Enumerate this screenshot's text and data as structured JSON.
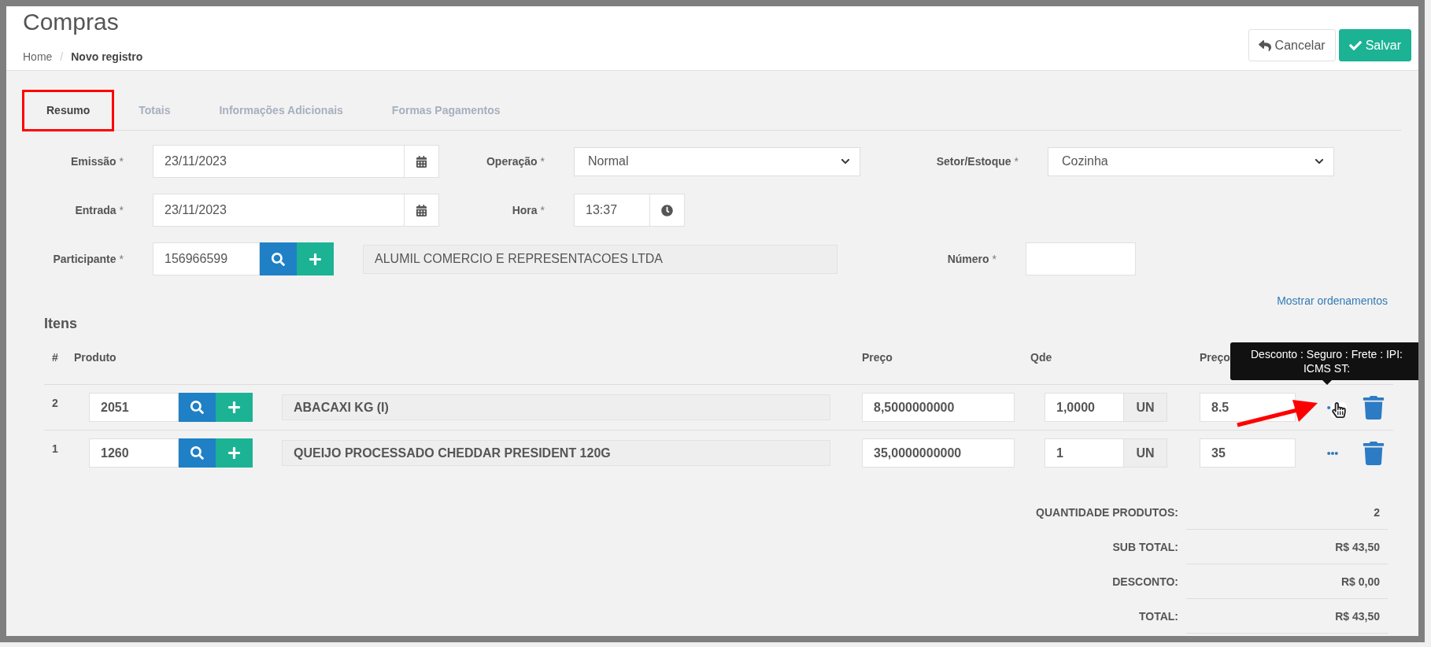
{
  "page": {
    "title": "Compras",
    "separator": "/",
    "breadcrumb": [
      {
        "label": "Home",
        "selected": false
      },
      {
        "label": "Novo registro",
        "selected": true
      }
    ]
  },
  "actions": [
    {
      "kind": "cancel",
      "label": "Cancelar"
    },
    {
      "kind": "save",
      "label": "Salvar"
    }
  ],
  "tabs": [
    {
      "label": "Resumo",
      "selected": true,
      "highlighted": true
    },
    {
      "label": "Totais",
      "selected": false,
      "highlighted": false
    },
    {
      "label": "Informações Adicionais",
      "selected": false,
      "highlighted": false
    },
    {
      "label": "Formas Pagamentos",
      "selected": false,
      "highlighted": false
    }
  ],
  "form": {
    "rows": [
      [
        {
          "kind": "date",
          "label": "Emissão",
          "mark": "*",
          "value": "23/11/2023"
        },
        {
          "kind": "select",
          "label": "Operação",
          "mark": "*",
          "value": "Normal"
        },
        {
          "kind": "select",
          "label": "Setor/Estoque",
          "mark": "*",
          "value": "Cozinha"
        }
      ],
      [
        {
          "kind": "date",
          "label": "Entrada",
          "mark": "*",
          "value": "23/11/2023"
        },
        {
          "kind": "time",
          "label": "Hora",
          "mark": "*",
          "value": "13:37"
        }
      ],
      [
        {
          "kind": "lookup",
          "label": "Participante",
          "mark": "*",
          "value": "156966599"
        },
        {
          "kind": "readonly",
          "value": "ALUMIL COMERCIO E REPRESENTACOES LTDA"
        },
        {
          "kind": "text",
          "label": "Número",
          "mark": "*"
        }
      ]
    ]
  },
  "sort_link": "Mostrar ordenamentos",
  "items_title": "Itens",
  "items_columns": [
    "#",
    "Produto",
    "Preço",
    "Qde",
    "Preço"
  ],
  "items": [
    {
      "number": "2",
      "code": "2051",
      "product": "ABACAXI KG (I)",
      "price": "8,5000000000",
      "quantity": "1,0000",
      "unit": "UN",
      "total": "8.5",
      "hovered": true,
      "tooltip": "Desconto : Seguro : Frete : IPI: ICMS ST:",
      "arrow_pointed": true
    },
    {
      "number": "1",
      "code": "1260",
      "product": "QUEIJO PROCESSADO CHEDDAR PRESIDENT 120G",
      "price": "35,0000000000",
      "quantity": "1",
      "unit": "UN",
      "total": "35",
      "hovered": false,
      "arrow_pointed": false
    }
  ],
  "totals": [
    {
      "label": "QUANTIDADE PRODUTOS:",
      "value": "2"
    },
    {
      "label": "SUB TOTAL:",
      "value": "R$ 43,50"
    },
    {
      "label": "DESCONTO:",
      "value": "R$ 0,00"
    },
    {
      "label": "TOTAL:",
      "value": "R$ 43,50"
    }
  ]
}
